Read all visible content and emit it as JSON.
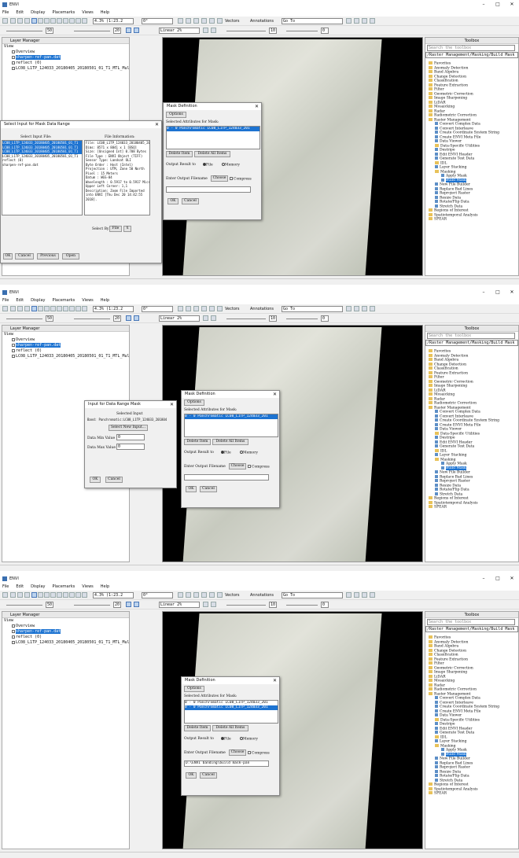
{
  "app": {
    "title": "ENVI",
    "menu": [
      "File",
      "Edit",
      "Display",
      "Placemarks",
      "Views",
      "Help"
    ],
    "window_controls": [
      "–",
      "□",
      "✕"
    ],
    "toolbar": {
      "zoom_value": "4.3% (1:23.2",
      "rotation_value": "0°",
      "stretch_value": "Linear 2%",
      "brightness_value": "50",
      "contrast_value": "20",
      "sharpen_value": "10",
      "transparency_value": "0",
      "vectors_label": "Vectors",
      "annotations_label": "Annotations",
      "goto_label": "Go To"
    },
    "layer_manager": {
      "title": "Layer Manager",
      "items": [
        "View",
        "Overview",
        "sharpen-ref-pan.dat",
        "reflect (0)",
        "LC08_L1TP_124033_20180405_20180501_01_T1_MTL_Mult"
      ]
    },
    "toolbox": {
      "title": "Toolbox",
      "search_placeholder": "Search the toolbox",
      "path": "/Raster Management/Masking/Build Mask",
      "items": [
        "Favorites",
        "Anomaly Detection",
        "Band Algebra",
        "Change Detection",
        "Classification",
        "Feature Extraction",
        "Filter",
        "Geometric Correction",
        "Image Sharpening",
        "LiDAR",
        "Mosaicking",
        "Radar",
        "Radiometric Correction",
        "Raster Management",
        "Convert Complex Data",
        "Convert Interleave",
        "Create Coordinate System String",
        "Create ENVI Meta File",
        "Data Viewer",
        "Data-Specific Utilities",
        "Destripe",
        "Edit ENVI Header",
        "Generate Test Data",
        "IDL",
        "Layer Stacking",
        "Masking",
        "Apply Mask",
        "Build Mask",
        "New File Builder",
        "Replace Bad Lines",
        "Reproject Raster",
        "Resize Data",
        "Rotate/Flip Data",
        "Stretch Data",
        "Regions of Interest",
        "Spatiotemporal Analysis",
        "SPEAR"
      ]
    }
  },
  "panel1": {
    "select_input_dialog": {
      "title": "Select Input for Mask Data Range",
      "list_header": "Select Input File:",
      "files": [
        "LC08_L1TP_124033_20180405_20180501_01_T1",
        "LC08_L1TP_124033_20180405_20180501_01_T1",
        "LC08_L1TP_124033_20180405_20180501_01_T1",
        "LC08_L1TP_124033_20180405_20180501_01_T1",
        "reflect (0)",
        "sharpen-ref-pan.dat"
      ],
      "info_header": "File Information:",
      "info_lines": [
        "File: LC08_L1TP_124033_20180405_20180501_",
        "Dims: 8571 x 8841 x 1 [BSQ]",
        "Size: [Unsigned Int] 0.708 Bytes",
        "File Type : ENVI Object (TIFF)",
        "Sensor Type: Landsat OLI",
        "Byte Order : Host (Intel)",
        "Projection : UTM, Zone 50 North",
        "  Pixel     : 15 Meters",
        "  Datum     : WGS-84",
        "Wavelength : 0.5917 to 0.5917 Micrometers",
        "Upper Left Corner: 1,1",
        "Description: Zoom File Imported",
        "into ENVI [Thu Dec 20 14:42:55",
        "2018]."
      ],
      "select_by_label": "Select By",
      "select_by_value": "File",
      "buttons": [
        "OK",
        "Cancel",
        "Previous",
        "Open"
      ]
    },
    "mask_def": {
      "title": "Mask Definition",
      "options_label": "Options",
      "attr_header": "Selected Attributes for Mask:",
      "attrs": [
        "0 - 0  Panchromatic LC08_L1TP_124033_201"
      ],
      "delete_item": "Delete Item",
      "delete_all": "Delete All Items",
      "output_label": "Output Result to",
      "file_option": "File",
      "memory_option": "Memory",
      "filename_label": "Enter Output Filename",
      "choose": "Choose",
      "compress": "Compress",
      "filename_value": "",
      "ok": "OK",
      "cancel": "Cancel"
    }
  },
  "panel2": {
    "range_dialog": {
      "title": "Input for Data Range Mask",
      "selected_input_label": "Selected Input",
      "band_text": "Band: Panchromatic:LC08_L1TP_124033_201804",
      "select_new_input": "Select New Input...",
      "min_label": "Data Min Value",
      "min_value": "0",
      "max_label": "Data Max Value",
      "max_value": "0",
      "ok": "OK",
      "cancel": "Cancel"
    },
    "mask_def": {
      "title": "Mask Definition",
      "options_label": "Options",
      "attr_header": "Selected Attributes for Mask:",
      "attrs": [
        "0 - 0  Panchromatic LC08_L1TP_124033_201"
      ],
      "delete_item": "Delete Item",
      "delete_all": "Delete All Items",
      "output_label": "Output Result to",
      "file_option": "File",
      "memory_option": "Memory",
      "filename_label": "Enter Output Filename",
      "choose": "Choose",
      "compress": "Compress",
      "filename_value": "",
      "ok": "OK",
      "cancel": "Cancel"
    }
  },
  "panel3": {
    "mask_def": {
      "title": "Mask Definition",
      "options_label": "Options",
      "attr_header": "Selected Attributes for Mask:",
      "attrs": [
        "0 - 0  Panchromatic LC08_L1TP_124033_201",
        "0 - 0  Panchromatic LC08_L1TP_124033_201"
      ],
      "delete_item": "Delete Item",
      "delete_all": "Delete All Items",
      "output_label": "Output Result to",
      "file_option": "File",
      "memory_option": "Memory",
      "filename_label": "Enter Output Filename",
      "choose": "Choose",
      "compress": "Compress",
      "filename_value": "D:\\ENVI banding\\build mask-pan",
      "ok": "OK",
      "cancel": "Cancel"
    }
  }
}
